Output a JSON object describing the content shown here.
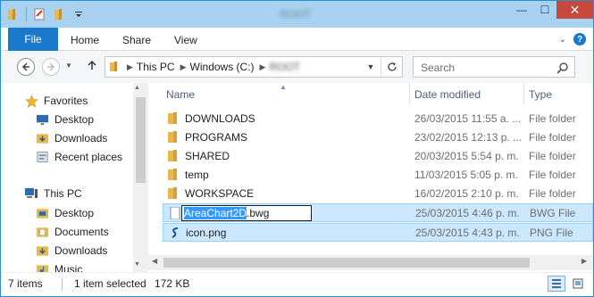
{
  "window": {
    "title": "ROOT",
    "controls": {
      "minimize": "—",
      "maximize": "☐",
      "close": "✕"
    }
  },
  "ribbon": {
    "file": "File",
    "tabs": [
      "Home",
      "Share",
      "View"
    ],
    "help": "?"
  },
  "address": {
    "crumbs": [
      "This PC",
      "Windows (C:)",
      "ROOT"
    ]
  },
  "search": {
    "placeholder": "Search"
  },
  "nav_pane": {
    "favorites_label": "Favorites",
    "favorites": [
      "Desktop",
      "Downloads",
      "Recent places"
    ],
    "this_pc_label": "This PC",
    "this_pc": [
      "Desktop",
      "Documents",
      "Downloads",
      "Music"
    ]
  },
  "columns": {
    "name": "Name",
    "date": "Date modified",
    "type": "Type"
  },
  "files": [
    {
      "name": "DOWNLOADS",
      "date": "26/03/2015 11:55 a. ...",
      "type": "File folder",
      "icon": "folder-icon"
    },
    {
      "name": "PROGRAMS",
      "date": "23/02/2015 12:13 p. ...",
      "type": "File folder",
      "icon": "folder-icon"
    },
    {
      "name": "SHARED",
      "date": "20/03/2015 5:54 p. m.",
      "type": "File folder",
      "icon": "folder-icon"
    },
    {
      "name": "temp",
      "date": "11/03/2015 5:05 p. m.",
      "type": "File folder",
      "icon": "folder-icon"
    },
    {
      "name": "WORKSPACE",
      "date": "16/02/2015 2:10 p. m.",
      "type": "File folder",
      "icon": "folder-icon"
    },
    {
      "name_selected": "AreaChart2D",
      "name_ext": ".bwg",
      "date": "25/03/2015 4:46 p. m.",
      "type": "BWG File",
      "icon": "document-icon"
    },
    {
      "name": "icon.png",
      "date": "25/03/2015 4:43 p. m.",
      "type": "PNG File",
      "icon": "png-file-icon"
    }
  ],
  "status": {
    "items": "7 items",
    "selected": "1 item selected",
    "size": "172 KB"
  },
  "colors": {
    "accent": "#1979ca",
    "title_bar": "#a9d1f0",
    "selection": "#cce8ff",
    "close": "#c7483c",
    "folder": "#e8b84a"
  }
}
